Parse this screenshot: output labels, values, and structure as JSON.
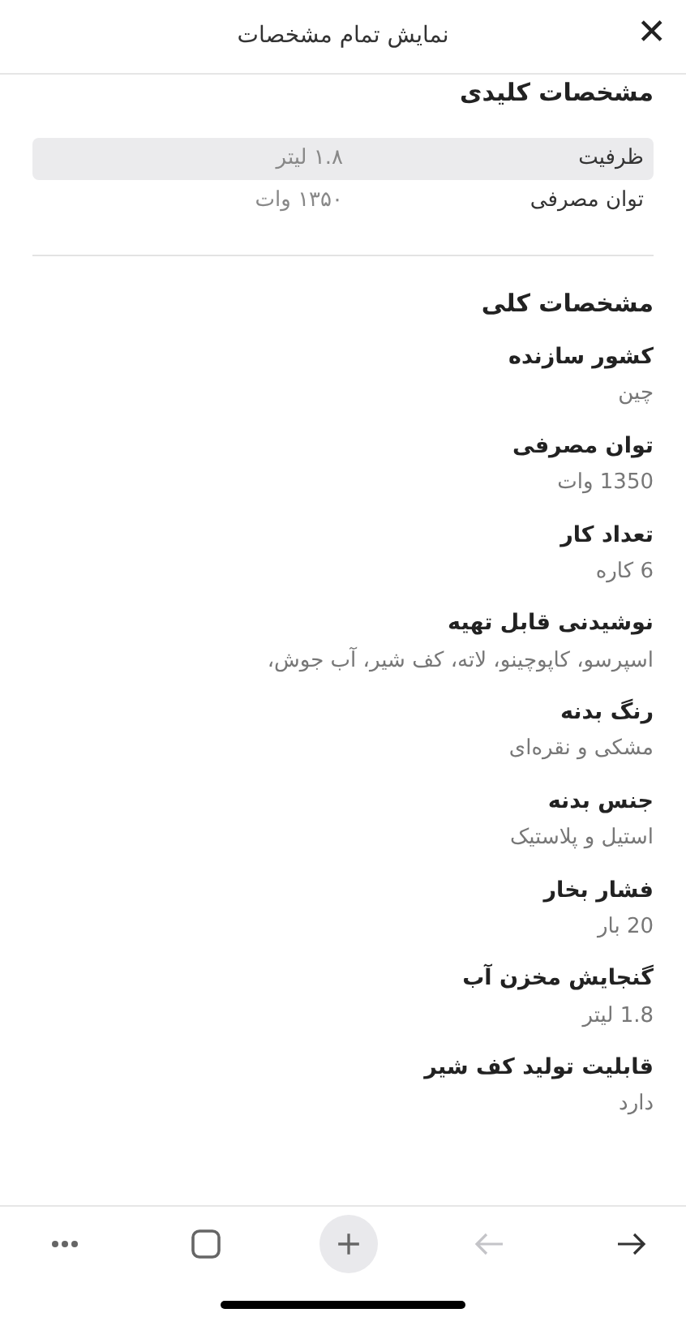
{
  "header": {
    "title": "نمایش تمام مشخصات",
    "close_icon": "✕"
  },
  "key_specs": {
    "title": "مشخصات کلیدی",
    "rows": [
      {
        "label": "ظرفیت",
        "value": "۱.۸ لیتر",
        "highlighted": true
      },
      {
        "label": "توان مصرفی",
        "value": "۱۳۵۰ وات",
        "highlighted": false
      }
    ]
  },
  "general_specs": {
    "title": "مشخصات کلی",
    "items": [
      {
        "label": "کشور سازنده",
        "value": "چین"
      },
      {
        "label": "توان مصرفی",
        "value": "1350 وات"
      },
      {
        "label": "تعداد کار",
        "value": "6 کاره"
      },
      {
        "label": "نوشیدنی قابل تهیه",
        "value": "اسپرسو، کاپوچینو، لاته، کف شیر، آب جوش،"
      },
      {
        "label": "رنگ بدنه",
        "value": "مشکی و نقره‌ای"
      },
      {
        "label": "جنس بدنه",
        "value": "استیل و پلاستیک"
      },
      {
        "label": "فشار بخار",
        "value": "20 بار"
      },
      {
        "label": "گنجایش مخزن آب",
        "value": "1.8 لیتر"
      },
      {
        "label": "قابلیت تولید کف شیر",
        "value": "دارد"
      }
    ]
  },
  "toolbar": [
    {
      "kind": "more",
      "disabled": false
    },
    {
      "kind": "tabs",
      "disabled": false
    },
    {
      "kind": "new-tab",
      "disabled": false
    },
    {
      "kind": "left-arrow",
      "disabled": true
    },
    {
      "kind": "right-arrow",
      "disabled": false
    }
  ]
}
